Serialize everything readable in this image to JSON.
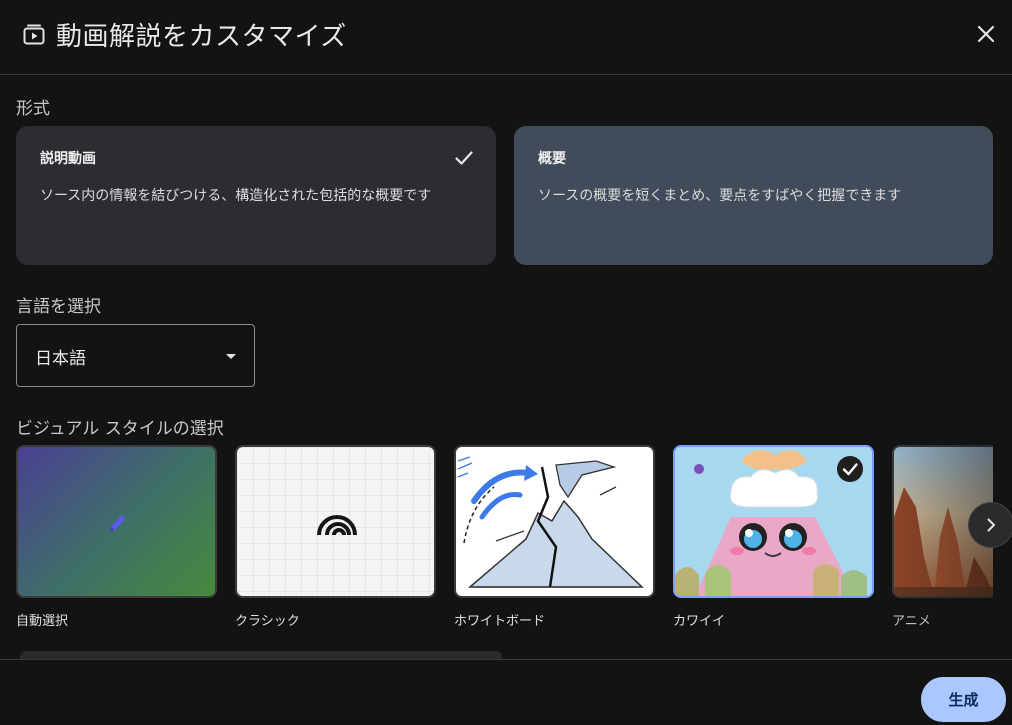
{
  "dialog": {
    "title": "動画解説をカスタマイズ",
    "title_icon": "video-stack-icon",
    "close_icon": "close-icon"
  },
  "format": {
    "label": "形式",
    "options": [
      {
        "title": "説明動画",
        "description": "ソース内の情報を結びつける、構造化された包括的な概要です",
        "selected": true
      },
      {
        "title": "概要",
        "description": "ソースの概要を短くまとめ、要点をすばやく把握できます",
        "selected": false
      }
    ]
  },
  "language": {
    "label": "言語を選択",
    "selected": "日本語"
  },
  "visual_style": {
    "label": "ビジュアル スタイルの選択",
    "options": [
      {
        "label": "自動選択",
        "icon": "pencil-icon",
        "selected": false
      },
      {
        "label": "クラシック",
        "icon": "arc-logo-icon",
        "selected": false
      },
      {
        "label": "ホワイトボード",
        "selected": false
      },
      {
        "label": "カワイイ",
        "selected": true
      },
      {
        "label": "アニメ",
        "selected": false
      }
    ],
    "next_icon": "chevron-right-icon"
  },
  "actions": {
    "generate_label": "生成"
  },
  "colors": {
    "background": "#131313",
    "card_selected": "#2b2d33",
    "card_other": "#414b5a",
    "accent": "#aac7ff",
    "selected_border": "#7c9cff"
  }
}
